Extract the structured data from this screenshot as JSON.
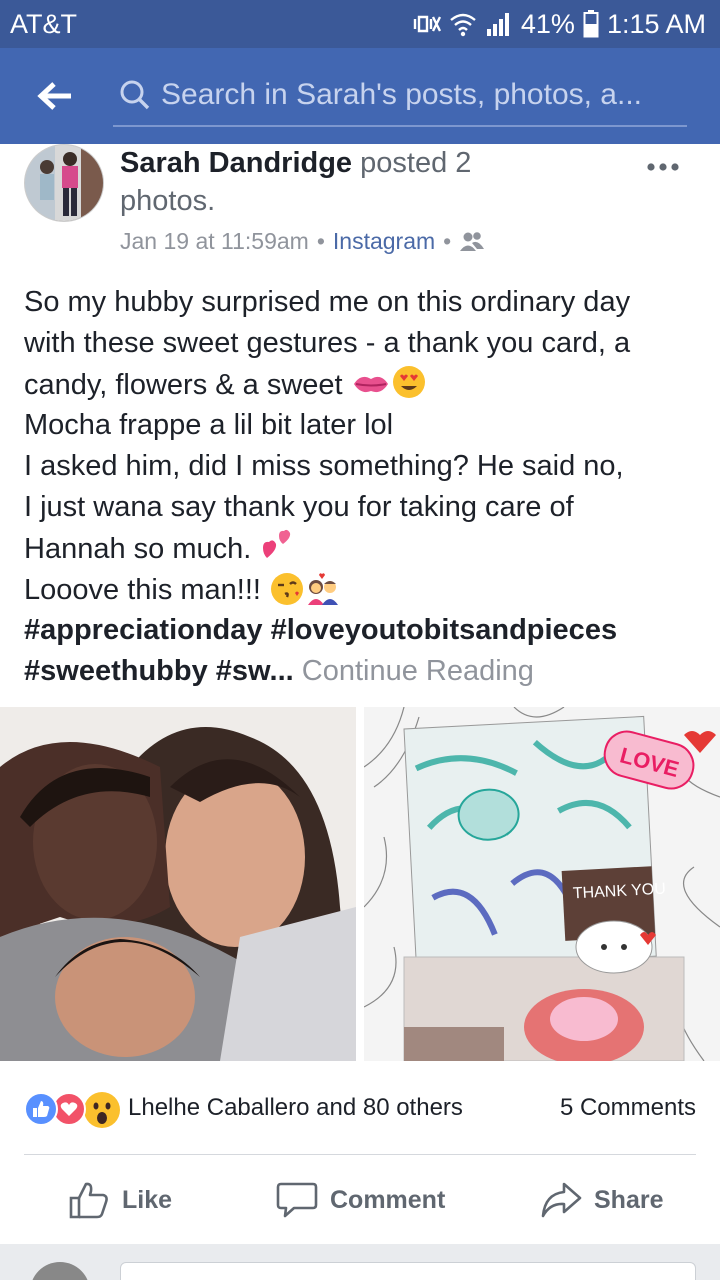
{
  "status_bar": {
    "carrier": "AT&T",
    "battery": "41%",
    "time": "1:15 AM",
    "icons": [
      "mute-vibrate-icon",
      "wifi-icon",
      "signal-icon",
      "battery-icon"
    ]
  },
  "search": {
    "placeholder": "Search in Sarah's posts, photos, a..."
  },
  "post": {
    "author": "Sarah Dandridge",
    "action": "posted 2 photos.",
    "timestamp": "Jan 19 at 11:59am",
    "separator": "•",
    "source": "Instagram",
    "privacy_icon": "friends-icon",
    "text_lines": [
      "So my hubby surprised me on this ordinary day",
      "with these sweet gestures - a thank you card, a",
      "candy, flowers & a sweet",
      "Mocha frappe a lil bit later lol",
      "I asked him, did I miss something? He said no,",
      "I just wana say thank you for taking care of",
      "Hannah so much.",
      "Looove this man!!!"
    ],
    "hashtags_line1": "#appreciationday #loveyoutobitsandpieces",
    "hashtags_line2": "#sweethubby #sw...",
    "continue_label": "Continue Reading",
    "photo_card_text": "THANK YOU",
    "photo_sticker_text": "LOVE"
  },
  "reactions": {
    "icons": [
      "like-reaction-icon",
      "love-reaction-icon",
      "wow-reaction-icon"
    ],
    "summary": "Lhelhe Caballero and 80 others",
    "comments": "5 Comments"
  },
  "actions": {
    "like": "Like",
    "comment": "Comment",
    "share": "Share"
  },
  "colors": {
    "header": "#4267b2",
    "status": "#3b5998",
    "link": "#4b6aa7",
    "muted": "#90949c"
  }
}
